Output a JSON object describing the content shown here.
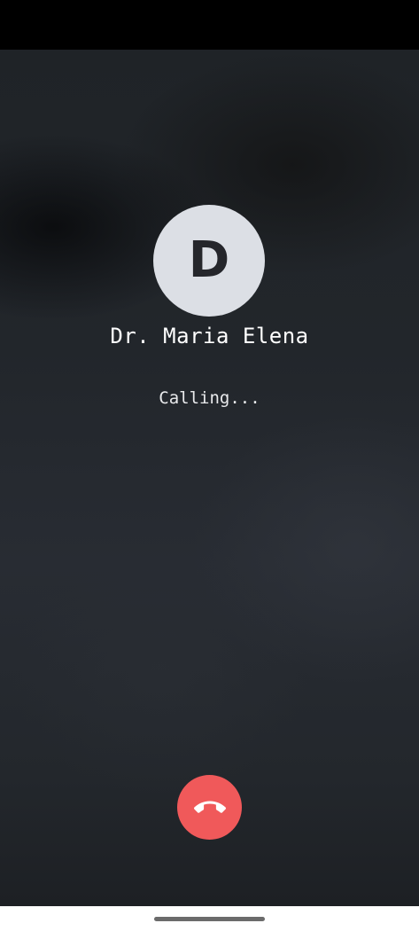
{
  "call": {
    "avatar_initial": "D",
    "contact_name": "Dr. Maria Elena",
    "status": "Calling..."
  },
  "icons": {
    "end_call": "phone-hangup-icon"
  },
  "colors": {
    "status_bar": "#000000",
    "background": "#23272c",
    "avatar_background": "#dcdfe5",
    "avatar_text": "#25262b",
    "end_call_button": "#f0595a",
    "nav_bar": "#ffffff",
    "home_handle": "#6b6b6b"
  }
}
